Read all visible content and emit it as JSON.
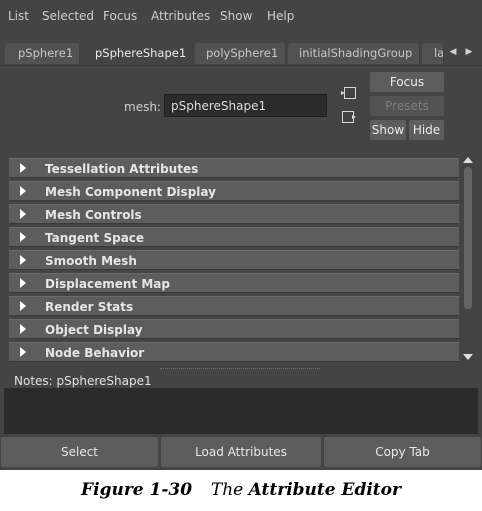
{
  "menubar": {
    "items": [
      "List",
      "Selected",
      "Focus",
      "Attributes",
      "Show",
      "Help"
    ]
  },
  "tabs": {
    "items": [
      "pSphere1",
      "pSphereShape1",
      "polySphere1",
      "initialShadingGroup",
      "la"
    ],
    "active": "pSphereShape1",
    "prev_icon": "triangle-left",
    "next_icon": "triangle-right"
  },
  "node": {
    "label": "mesh:",
    "value": "pSphereShape1",
    "load_icon": "load-selected-icon",
    "copy_icon": "copy-tab-icon"
  },
  "buttons": {
    "focus": "Focus",
    "presets": "Presets",
    "show": "Show",
    "hide": "Hide"
  },
  "sections": [
    "Tessellation Attributes",
    "Mesh Component Display",
    "Mesh Controls",
    "Tangent Space",
    "Smooth Mesh",
    "Displacement Map",
    "Render Stats",
    "Object Display",
    "Node Behavior"
  ],
  "notes": {
    "label": "Notes:",
    "node": "pSphereShape1"
  },
  "bottom": {
    "select": "Select",
    "load": "Load Attributes",
    "copy": "Copy Tab"
  },
  "caption": {
    "fig": "Figure 1-30",
    "pre": "The",
    "main": "Attribute Editor"
  },
  "colors": {
    "panel": "#444444",
    "section": "#5d5d5d",
    "field": "#2b2b2b",
    "text": "#cfcfcf"
  }
}
